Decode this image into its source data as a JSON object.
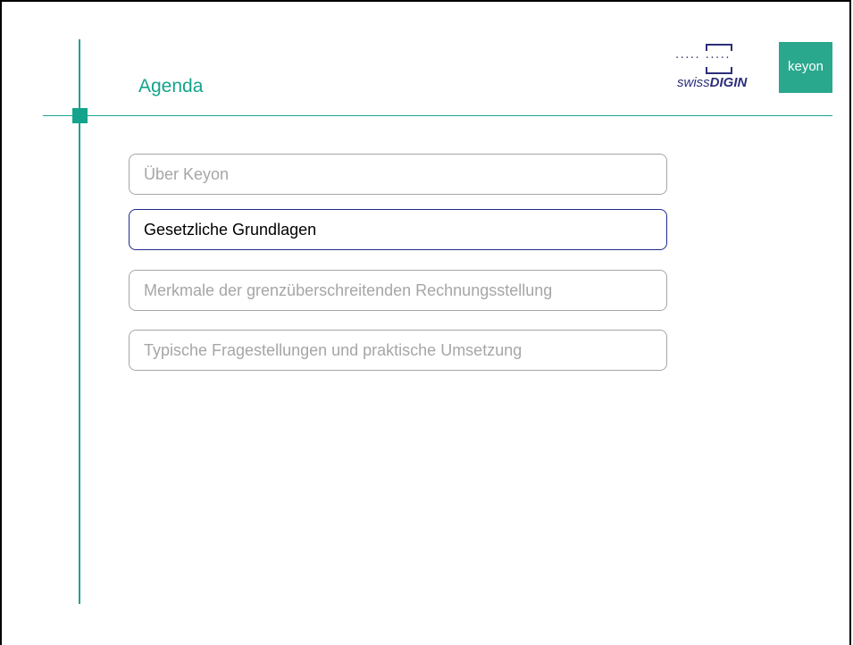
{
  "slide": {
    "title": "Agenda",
    "agenda_items": [
      {
        "label": "Über Keyon",
        "active": false
      },
      {
        "label": "Gesetzliche Grundlagen",
        "active": true
      },
      {
        "label": "Merkmale der grenzüberschreitenden Rechnungsstellung",
        "active": false
      },
      {
        "label": "Typische Fragestellungen und praktische Umsetzung",
        "active": false
      }
    ]
  },
  "logos": {
    "swissdigin": {
      "swiss": "swiss",
      "digin": "DIGIN",
      "dots": "·····  ·····"
    },
    "keyon": {
      "text": "keyon"
    }
  },
  "colors": {
    "accent": "#14a38c",
    "active_border": "#1e2a8a",
    "inactive_text": "#a6a6a6",
    "swissdigin_blue": "#2b2f7a",
    "keyon_green": "#2aa88e"
  }
}
